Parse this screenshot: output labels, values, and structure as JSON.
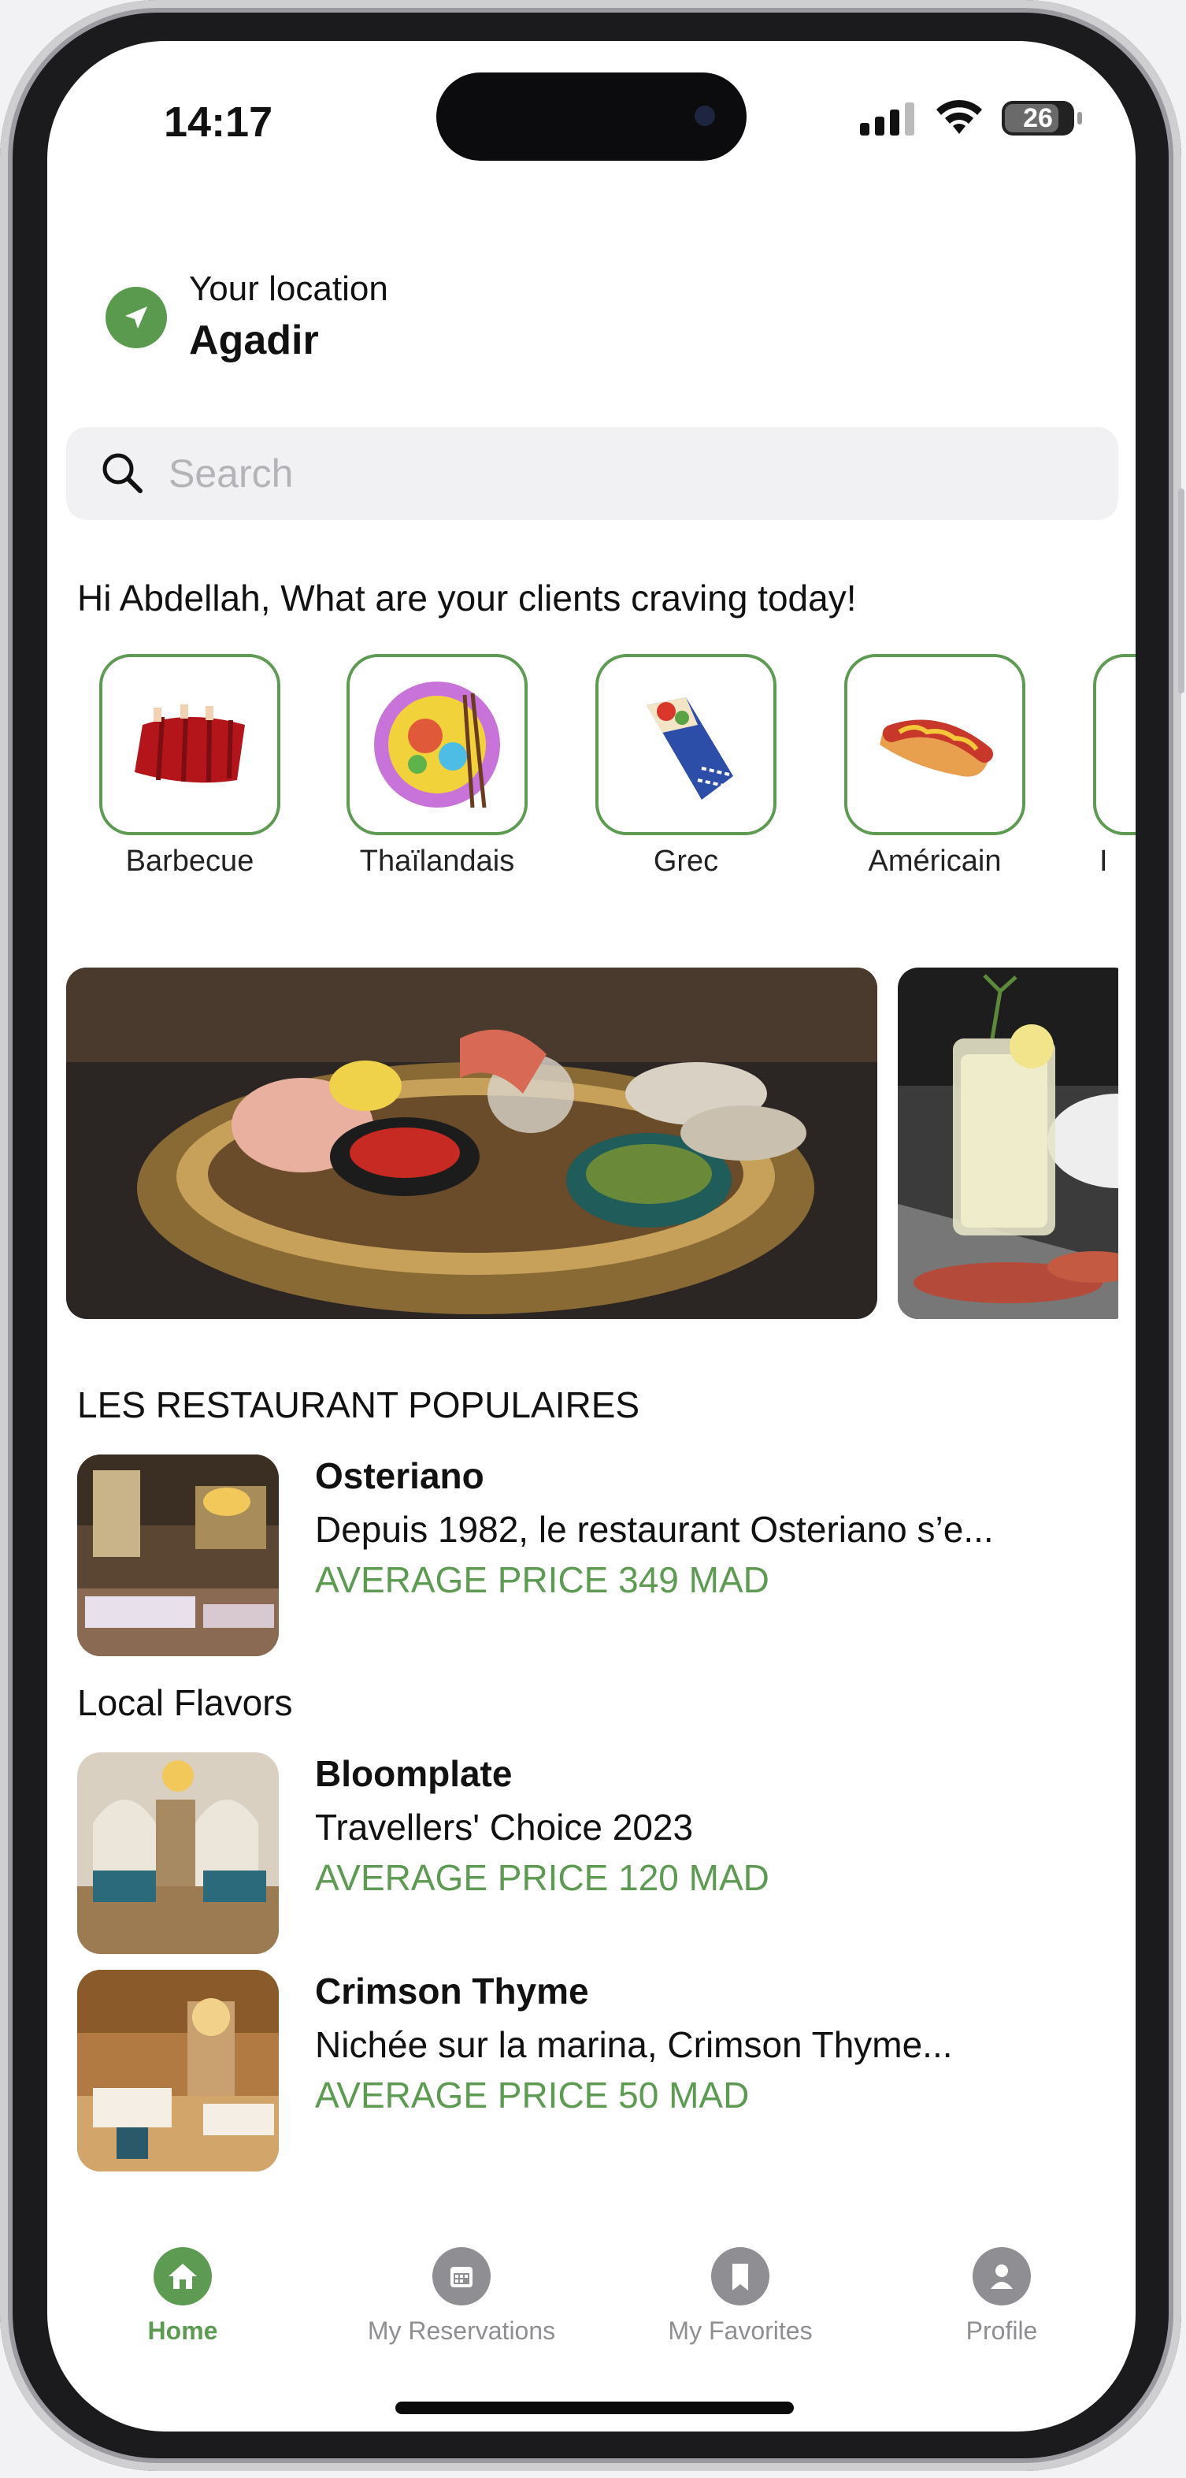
{
  "status_bar": {
    "time": "14:17",
    "battery": "26"
  },
  "location": {
    "label": "Your location",
    "city": "Agadir"
  },
  "search": {
    "placeholder": "Search"
  },
  "greeting": "Hi Abdellah, What are your clients craving today!",
  "categories": [
    {
      "label": "Barbecue",
      "icon": "ribs-icon"
    },
    {
      "label": "Thaïlandais",
      "icon": "thai-bowl-icon"
    },
    {
      "label": "Grec",
      "icon": "gyro-wrap-icon"
    },
    {
      "label": "Américain",
      "icon": "hotdog-icon"
    },
    {
      "label": "I",
      "icon": "partial-category-icon"
    }
  ],
  "popular": {
    "title": "LES RESTAURANT POPULAIRES",
    "items": [
      {
        "name": "Osteriano",
        "desc": "Depuis 1982, le restaurant Osteriano s’e...",
        "price": "AVERAGE PRICE 349 MAD"
      }
    ]
  },
  "local": {
    "title": "Local Flavors",
    "items": [
      {
        "name": "Bloomplate",
        "desc": "Travellers' Choice 2023",
        "price": "AVERAGE PRICE 120 MAD"
      },
      {
        "name": "Crimson Thyme",
        "desc": "Nichée sur la marina, Crimson Thyme...",
        "price": "AVERAGE PRICE 50 MAD"
      }
    ]
  },
  "tabs": [
    {
      "label": "Home",
      "icon": "home-icon",
      "active": true
    },
    {
      "label": "My Reservations",
      "icon": "calendar-icon",
      "active": false
    },
    {
      "label": "My Favorites",
      "icon": "bookmark-icon",
      "active": false
    },
    {
      "label": "Profile",
      "icon": "person-icon",
      "active": false
    }
  ],
  "colors": {
    "accent": "#5d9a52",
    "inactive": "#8e8e93"
  }
}
